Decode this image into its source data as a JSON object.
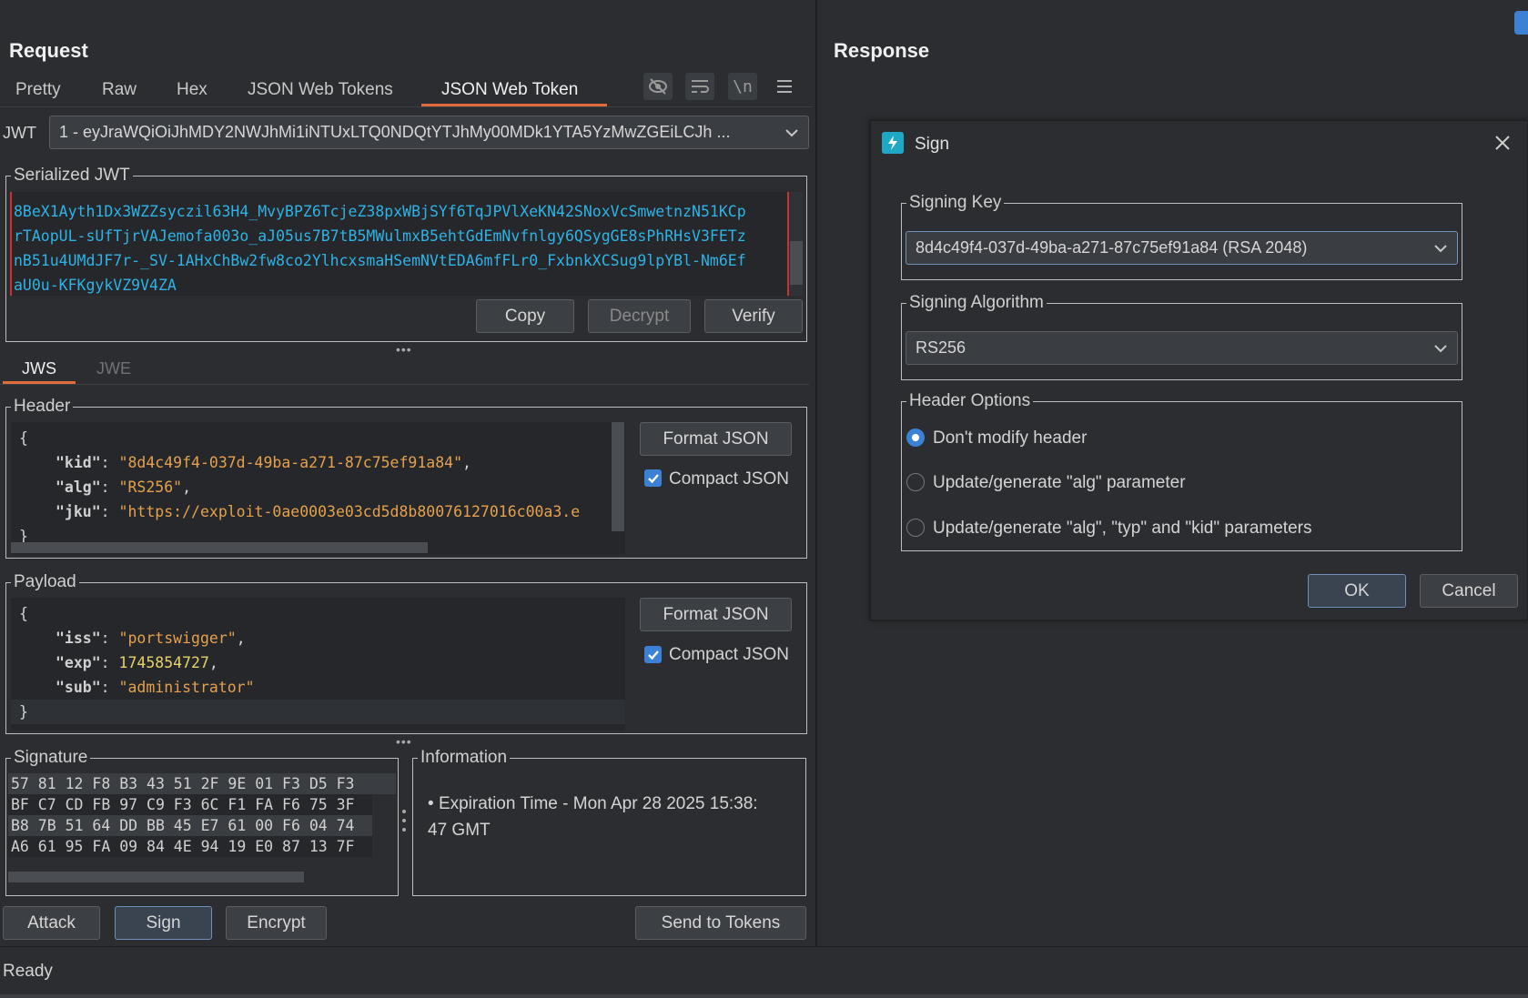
{
  "request": {
    "title": "Request",
    "tabs": [
      "Pretty",
      "Raw",
      "Hex",
      "JSON Web Tokens",
      "JSON Web Token"
    ],
    "active_tab": "JSON Web Token",
    "toolbar_icons": [
      "eye-slash-icon",
      "wrap-lines-icon",
      "newline-icon",
      "menu-icon"
    ],
    "newline_label": "\\n",
    "jwt_label": "JWT",
    "jwt_selected": "1 - eyJraWQiOiJhMDY2NWJhMi1iNTUxLTQ0NDQtYTJhMy00MDk1YTA5YzMwZGEiLCJh ...",
    "serialized": {
      "legend": "Serialized JWT",
      "lines": [
        "8BeX1Ayth1Dx3WZZsyczil63H4_MvyBPZ6TcjeZ38pxWBjSYf6TqJPVlXeKN42SNoxVcSmwetnzN51KCp",
        "rTAopUL-sUfTjrVAJemofa003o_aJ05us7B7tB5MWulmxB5ehtGdEmNvfnlgy6QSygGE8sPhRHsV3FETz",
        "nB51u4UMdJF7r-_SV-1AHxChBw2fw8co2YlhcxsmaHSemNVtEDA6mfFLr0_FxbnkXCSug9lpYBl-Nm6Ef",
        "aU0u-KFKgykVZ9V4ZA"
      ],
      "copy": "Copy",
      "decrypt": "Decrypt",
      "verify": "Verify"
    },
    "sub_tabs": [
      "JWS",
      "JWE"
    ],
    "header": {
      "legend": "Header",
      "open": "{",
      "close": "}",
      "lines": [
        {
          "key": "\"kid\"",
          "value": "\"8d4c49f4-037d-49ba-a271-87c75ef91a84\"",
          "trail": ","
        },
        {
          "key": "\"alg\"",
          "value": "\"RS256\"",
          "trail": ","
        },
        {
          "key": "\"jku\"",
          "value": "\"https://exploit-0ae0003e03cd5d8b80076127016c00a3.e",
          "trail": ""
        }
      ],
      "format": "Format JSON",
      "compact": "Compact JSON"
    },
    "payload": {
      "legend": "Payload",
      "open": "{",
      "close": "}",
      "lines": [
        {
          "key": "\"iss\"",
          "value": "\"portswigger\"",
          "trail": ",",
          "num": false
        },
        {
          "key": "\"exp\"",
          "value": "1745854727",
          "trail": ",",
          "num": true
        },
        {
          "key": "\"sub\"",
          "value": "\"administrator\"",
          "trail": "",
          "num": false
        }
      ],
      "format": "Format JSON",
      "compact": "Compact JSON"
    },
    "signature": {
      "legend": "Signature",
      "rows": [
        "57 81 12 F8 B3 43 51 2F 9E 01 F3 D5 F3",
        "BF C7 CD FB 97 C9 F3 6C F1 FA F6 75 3F",
        "B8 7B 51 64 DD BB 45 E7 61 00 F6 04 74",
        "A6 61 95 FA 09 84 4E 94 19 E0 87 13 7F"
      ]
    },
    "information": {
      "legend": "Information",
      "bullet": "•",
      "text": "Expiration Time - Mon Apr 28 2025 15:38:",
      "text2": "47 GMT"
    },
    "buttons": {
      "attack": "Attack",
      "sign": "Sign",
      "encrypt": "Encrypt",
      "send": "Send to Tokens"
    }
  },
  "response": {
    "title": "Response"
  },
  "dialog": {
    "title": "Sign",
    "signing_key": {
      "legend": "Signing Key",
      "value": "8d4c49f4-037d-49ba-a271-87c75ef91a84 (RSA 2048)"
    },
    "signing_algorithm": {
      "legend": "Signing Algorithm",
      "value": "RS256"
    },
    "header_options": {
      "legend": "Header Options",
      "options": [
        "Don't modify header",
        "Update/generate \"alg\" parameter",
        "Update/generate \"alg\", \"typ\" and \"kid\" parameters"
      ],
      "selected": 0
    },
    "ok": "OK",
    "cancel": "Cancel"
  },
  "status": {
    "text": "Ready"
  },
  "colors": {
    "accent": "#e06c3c",
    "jwt_text": "#2fb3e6",
    "string": "#e5a14d",
    "number": "#e8d26a",
    "checkbox": "#3b82d6"
  }
}
